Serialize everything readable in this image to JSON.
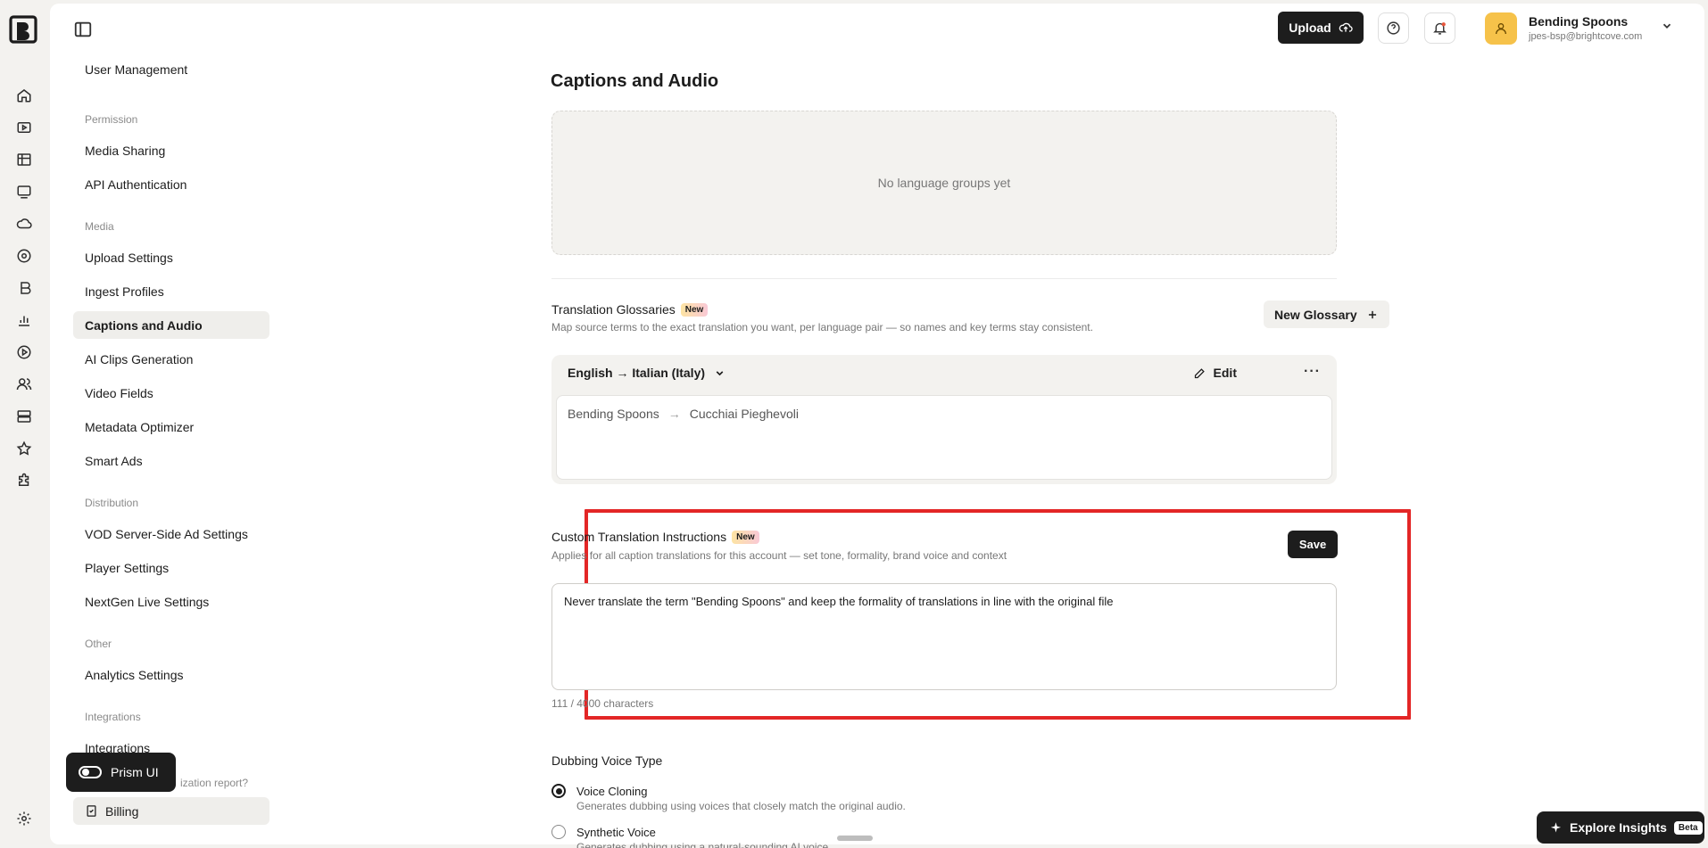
{
  "header": {
    "upload_label": "Upload",
    "user_name": "Bending Spoons",
    "user_email": "jpes-bsp@brightcove.com"
  },
  "sidebar": {
    "items": [
      {
        "label": "User Management",
        "type": "item"
      },
      {
        "label": "Permission",
        "type": "group"
      },
      {
        "label": "Media Sharing",
        "type": "item"
      },
      {
        "label": "API Authentication",
        "type": "item"
      },
      {
        "label": "Media",
        "type": "group"
      },
      {
        "label": "Upload Settings",
        "type": "item"
      },
      {
        "label": "Ingest Profiles",
        "type": "item"
      },
      {
        "label": "Captions and Audio",
        "type": "item",
        "active": true
      },
      {
        "label": "AI Clips Generation",
        "type": "item"
      },
      {
        "label": "Video Fields",
        "type": "item"
      },
      {
        "label": "Metadata Optimizer",
        "type": "item"
      },
      {
        "label": "Smart Ads",
        "type": "item"
      },
      {
        "label": "Distribution",
        "type": "group"
      },
      {
        "label": "VOD Server-Side Ad Settings",
        "type": "item"
      },
      {
        "label": "Player Settings",
        "type": "item"
      },
      {
        "label": "NextGen Live Settings",
        "type": "item"
      },
      {
        "label": "Other",
        "type": "group"
      },
      {
        "label": "Analytics Settings",
        "type": "item"
      },
      {
        "label": "Integrations",
        "type": "group"
      },
      {
        "label": "Integrations",
        "type": "item"
      }
    ],
    "org_report_text": "ization report?",
    "billing_label": "Billing",
    "prism_label": "Prism UI"
  },
  "main": {
    "page_title": "Captions and Audio",
    "language_groups_empty": "No language groups yet",
    "glossaries": {
      "title": "Translation Glossaries",
      "badge": "New",
      "subtitle": "Map source terms to the exact translation you want, per language pair — so names and key terms stay consistent.",
      "new_button": "New Glossary",
      "pair_label": "English → Italian (Italy)",
      "edit_label": "Edit",
      "more_label": "···",
      "source_term": "Bending Spoons",
      "arrow": "→",
      "target_term": "Cucchiai Pieghevoli"
    },
    "custom_instructions": {
      "title": "Custom Translation Instructions",
      "badge": "New",
      "subtitle": "Applies for all caption translations for this account — set tone, formality, brand voice and context",
      "save_label": "Save",
      "value": "Never translate the term \"Bending Spoons\" and keep the formality of translations in line with the original file",
      "char_count": "111 / 4000 characters"
    },
    "dubbing": {
      "title": "Dubbing Voice Type",
      "options": [
        {
          "label": "Voice Cloning",
          "desc": "Generates dubbing using voices that closely match the original audio.",
          "selected": true
        },
        {
          "label": "Synthetic Voice",
          "desc": "Generates dubbing using a natural-sounding AI voice.",
          "selected": false
        }
      ]
    },
    "explore_label": "Explore Insights",
    "beta_label": "Beta"
  },
  "colors": {
    "accent_dark": "#1d1d1d",
    "highlight": "#e32626",
    "surface": "#f3f2ef"
  }
}
